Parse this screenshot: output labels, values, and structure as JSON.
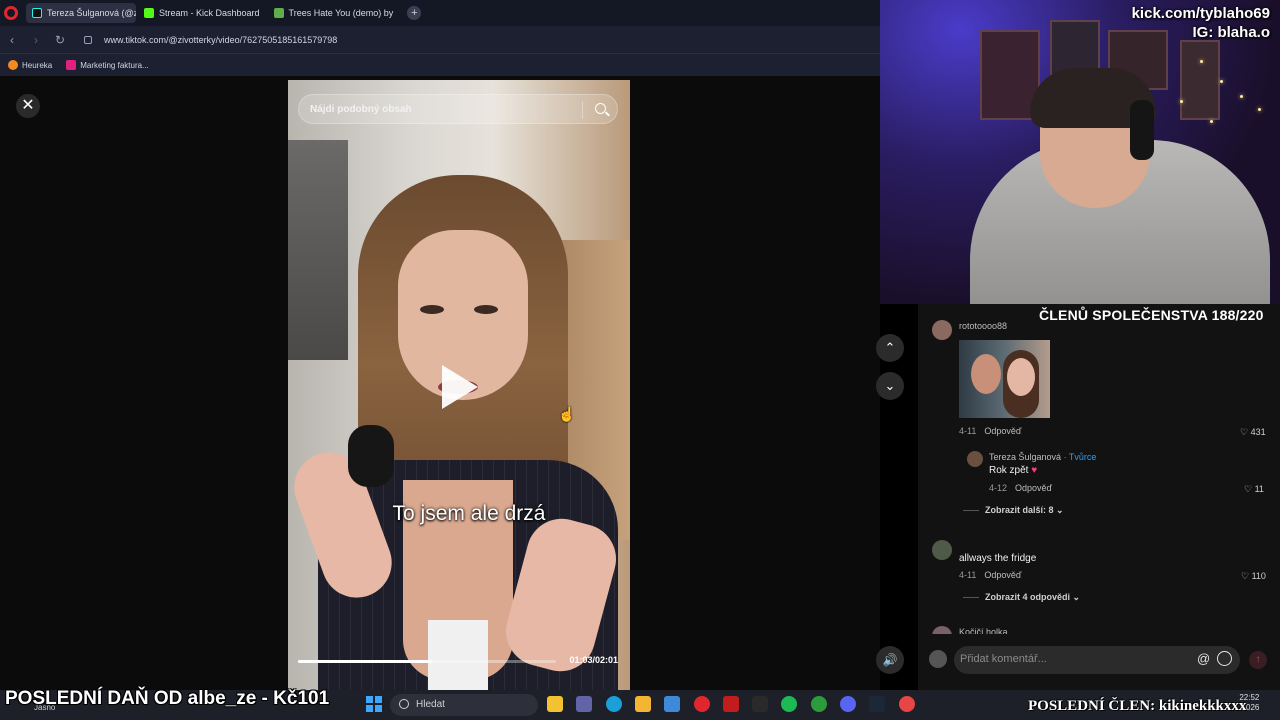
{
  "browser": {
    "tabs": [
      {
        "label": "Tereza Šulganová (@zivot",
        "icon_color": "#111111",
        "active": true
      },
      {
        "label": "Stream - Kick Dashboard",
        "icon_color": "#53fc18",
        "active": false
      },
      {
        "label": "Trees Hate You (demo) by",
        "icon_color": "#5fae4a",
        "active": false
      }
    ],
    "new_tab_label": "+",
    "url": "www.tiktok.com/@zivotterky/video/7627505185161579798",
    "bookmarks": [
      {
        "label": "Heureka",
        "icon_color": "#f28a1f"
      },
      {
        "label": "Marketing faktura...",
        "icon_color": "#e3207f"
      }
    ]
  },
  "video": {
    "search_placeholder": "Nájdi podobný obsah",
    "caption": "To jsem ale drzá",
    "time": "01:03/02:01",
    "progress_fraction": 0.52
  },
  "webcam": {
    "kick_url": "kick.com/tyblaho69",
    "instagram": "IG: blaha.o"
  },
  "members_overlay": "ČLENŮ SPOLEČENSTVA 188/220",
  "comments": {
    "c1": {
      "username": "rototoooo88",
      "date": "4-11",
      "reply_label": "Odpověď",
      "likes": "431"
    },
    "reply": {
      "username": "Tereza Šulganová",
      "creator_tag": "· Tvůrce",
      "text": "Rok zpět",
      "date": "4-12",
      "reply_label": "Odpověď",
      "likes": "11"
    },
    "show_more_1": "Zobrazit další: 8",
    "c2": {
      "text": "allways the fridge",
      "date": "4-11",
      "reply_label": "Odpověď",
      "likes": "110"
    },
    "show_more_2": "Zobrazit 4 odpovědi",
    "c3": {
      "username": "Kočičí holka"
    }
  },
  "comment_input": {
    "placeholder": "Přidat komentář...",
    "mention_symbol": "@"
  },
  "taskbar": {
    "weather": "Jasno",
    "search_label": "Hledat",
    "time": "22:52",
    "date": "…026",
    "apps": [
      {
        "name": "file-explorer",
        "color": "#f2c230"
      },
      {
        "name": "teams",
        "color": "#6264a7"
      },
      {
        "name": "edge",
        "color": "#1a9fd8"
      },
      {
        "name": "folder",
        "color": "#f2b632"
      },
      {
        "name": "store",
        "color": "#3f8ad8"
      },
      {
        "name": "opera",
        "color": "#e1262d"
      },
      {
        "name": "app-red",
        "color": "#c21d1d"
      },
      {
        "name": "epic-games",
        "color": "#2a2a2a"
      },
      {
        "name": "spotify",
        "color": "#1db954"
      },
      {
        "name": "xbox",
        "color": "#2c9b3c"
      },
      {
        "name": "discord",
        "color": "#5865f2"
      },
      {
        "name": "steam",
        "color": "#1b2838"
      },
      {
        "name": "app-gear",
        "color": "#e84545"
      }
    ]
  },
  "overlays": {
    "last_donation": "POSLEDNÍ DAŇ OD albe_ze - Kč101",
    "last_member": "POSLEDNÍ ČLEN: kikinekkkxxx"
  }
}
